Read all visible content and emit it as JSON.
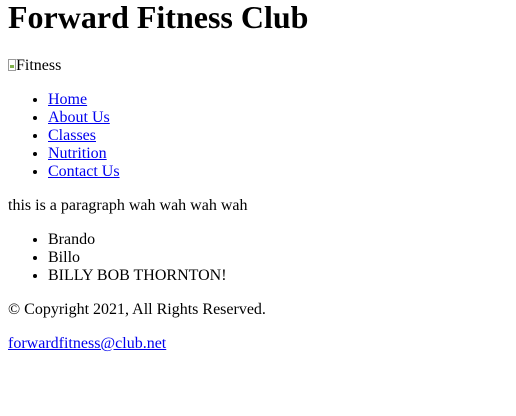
{
  "header": {
    "title": "Forward Fitness Club"
  },
  "hero": {
    "image_alt": "Fitness"
  },
  "nav": {
    "items": [
      {
        "label": "Home"
      },
      {
        "label": "About Us"
      },
      {
        "label": "Classes"
      },
      {
        "label": "Nutrition"
      },
      {
        "label": "Contact Us"
      }
    ]
  },
  "content": {
    "paragraph": "this is a paragraph wah wah wah wah",
    "list": [
      "Brando",
      "Billo",
      "BILLY BOB THORNTON!"
    ]
  },
  "footer": {
    "copyright": "© Copyright 2021, All Rights Reserved.",
    "email": "forwardfitness@club.net"
  },
  "colors": {
    "link": "#0000ee",
    "text": "#000000",
    "background": "#ffffff"
  }
}
